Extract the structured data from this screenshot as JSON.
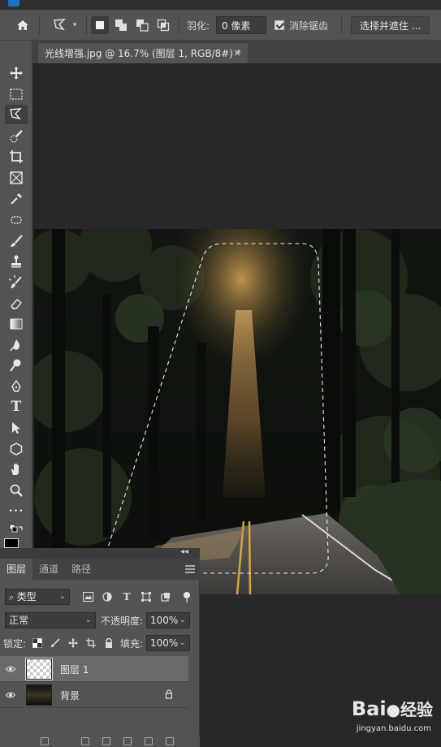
{
  "options_bar": {
    "feather_label": "羽化:",
    "feather_value": "0 像素",
    "antialias_label": "消除锯齿",
    "antialias_checked": true,
    "select_mask_button": "选择并遮住 ..."
  },
  "document_tab": {
    "title": "光线增强.jpg @ 16.7% (图层 1, RGB/8#) *",
    "close": "×"
  },
  "toolbar": {
    "tools": [
      "move-tool",
      "rect-marquee-tool",
      "polygonal-lasso-tool",
      "quick-selection-tool",
      "crop-tool",
      "frame-tool",
      "eyedropper-tool",
      "healing-brush-tool",
      "brush-tool",
      "clone-stamp-tool",
      "history-brush-tool",
      "eraser-tool",
      "gradient-tool",
      "blur-tool",
      "dodge-tool",
      "pen-tool",
      "type-tool",
      "path-selection-tool",
      "shape-tool",
      "hand-tool",
      "zoom-tool",
      "more-tools"
    ],
    "active_tool": "polygonal-lasso-tool",
    "type_glyph": "T",
    "more_glyph": "•••"
  },
  "layers_panel": {
    "collapse": "◂◂",
    "tabs": [
      "图层",
      "通道",
      "路径"
    ],
    "active_tab": "图层",
    "filter_kind": "类型",
    "blend_mode": "正常",
    "opacity_label": "不透明度:",
    "opacity_value": "100%",
    "lock_label": "锁定:",
    "fill_label": "填充:",
    "fill_value": "100%",
    "layers": [
      {
        "name": "图层 1",
        "selected": true,
        "visible": true
      },
      {
        "name": "背景",
        "selected": false,
        "visible": true,
        "locked": true
      }
    ]
  },
  "watermark": {
    "logo": "Bai",
    "logo_suffix": "经验",
    "url": "jingyan.baidu.com"
  },
  "colors": {
    "ui_panel": "#535353",
    "canvas_bg": "#282828",
    "selected_layer": "#6a6a6a",
    "light_ray": "#e8b46a"
  }
}
